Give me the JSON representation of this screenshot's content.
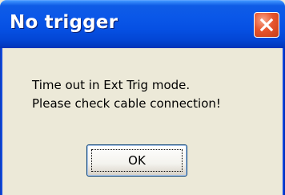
{
  "dialog": {
    "title": "No trigger",
    "message_lines": [
      "Time out in Ext Trig mode.",
      "Please check cable connection!"
    ],
    "ok_label": "OK"
  },
  "icons": {
    "close": "close-icon"
  },
  "colors": {
    "titlebar_blue": "#0a57e8",
    "close_red": "#e7552d",
    "dialog_background": "#ece9d8"
  }
}
